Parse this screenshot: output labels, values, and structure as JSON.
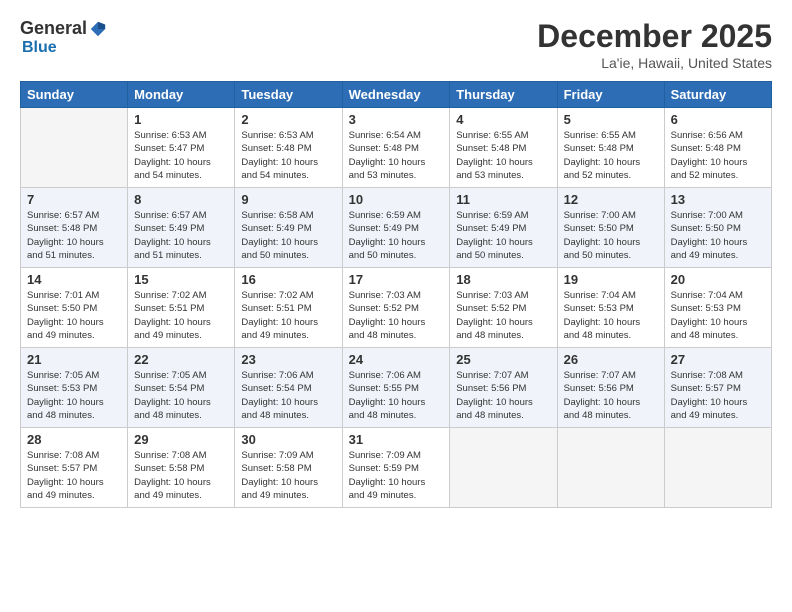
{
  "logo": {
    "general": "General",
    "blue": "Blue"
  },
  "title": "December 2025",
  "location": "La'ie, Hawaii, United States",
  "days_of_week": [
    "Sunday",
    "Monday",
    "Tuesday",
    "Wednesday",
    "Thursday",
    "Friday",
    "Saturday"
  ],
  "weeks": [
    [
      {
        "day": "",
        "empty": true
      },
      {
        "day": "1",
        "sunrise": "6:53 AM",
        "sunset": "5:47 PM",
        "daylight": "10 hours and 54 minutes."
      },
      {
        "day": "2",
        "sunrise": "6:53 AM",
        "sunset": "5:48 PM",
        "daylight": "10 hours and 54 minutes."
      },
      {
        "day": "3",
        "sunrise": "6:54 AM",
        "sunset": "5:48 PM",
        "daylight": "10 hours and 53 minutes."
      },
      {
        "day": "4",
        "sunrise": "6:55 AM",
        "sunset": "5:48 PM",
        "daylight": "10 hours and 53 minutes."
      },
      {
        "day": "5",
        "sunrise": "6:55 AM",
        "sunset": "5:48 PM",
        "daylight": "10 hours and 52 minutes."
      },
      {
        "day": "6",
        "sunrise": "6:56 AM",
        "sunset": "5:48 PM",
        "daylight": "10 hours and 52 minutes."
      }
    ],
    [
      {
        "day": "7",
        "sunrise": "6:57 AM",
        "sunset": "5:48 PM",
        "daylight": "10 hours and 51 minutes."
      },
      {
        "day": "8",
        "sunrise": "6:57 AM",
        "sunset": "5:49 PM",
        "daylight": "10 hours and 51 minutes."
      },
      {
        "day": "9",
        "sunrise": "6:58 AM",
        "sunset": "5:49 PM",
        "daylight": "10 hours and 50 minutes."
      },
      {
        "day": "10",
        "sunrise": "6:59 AM",
        "sunset": "5:49 PM",
        "daylight": "10 hours and 50 minutes."
      },
      {
        "day": "11",
        "sunrise": "6:59 AM",
        "sunset": "5:49 PM",
        "daylight": "10 hours and 50 minutes."
      },
      {
        "day": "12",
        "sunrise": "7:00 AM",
        "sunset": "5:50 PM",
        "daylight": "10 hours and 50 minutes."
      },
      {
        "day": "13",
        "sunrise": "7:00 AM",
        "sunset": "5:50 PM",
        "daylight": "10 hours and 49 minutes."
      }
    ],
    [
      {
        "day": "14",
        "sunrise": "7:01 AM",
        "sunset": "5:50 PM",
        "daylight": "10 hours and 49 minutes."
      },
      {
        "day": "15",
        "sunrise": "7:02 AM",
        "sunset": "5:51 PM",
        "daylight": "10 hours and 49 minutes."
      },
      {
        "day": "16",
        "sunrise": "7:02 AM",
        "sunset": "5:51 PM",
        "daylight": "10 hours and 49 minutes."
      },
      {
        "day": "17",
        "sunrise": "7:03 AM",
        "sunset": "5:52 PM",
        "daylight": "10 hours and 48 minutes."
      },
      {
        "day": "18",
        "sunrise": "7:03 AM",
        "sunset": "5:52 PM",
        "daylight": "10 hours and 48 minutes."
      },
      {
        "day": "19",
        "sunrise": "7:04 AM",
        "sunset": "5:53 PM",
        "daylight": "10 hours and 48 minutes."
      },
      {
        "day": "20",
        "sunrise": "7:04 AM",
        "sunset": "5:53 PM",
        "daylight": "10 hours and 48 minutes."
      }
    ],
    [
      {
        "day": "21",
        "sunrise": "7:05 AM",
        "sunset": "5:53 PM",
        "daylight": "10 hours and 48 minutes."
      },
      {
        "day": "22",
        "sunrise": "7:05 AM",
        "sunset": "5:54 PM",
        "daylight": "10 hours and 48 minutes."
      },
      {
        "day": "23",
        "sunrise": "7:06 AM",
        "sunset": "5:54 PM",
        "daylight": "10 hours and 48 minutes."
      },
      {
        "day": "24",
        "sunrise": "7:06 AM",
        "sunset": "5:55 PM",
        "daylight": "10 hours and 48 minutes."
      },
      {
        "day": "25",
        "sunrise": "7:07 AM",
        "sunset": "5:56 PM",
        "daylight": "10 hours and 48 minutes."
      },
      {
        "day": "26",
        "sunrise": "7:07 AM",
        "sunset": "5:56 PM",
        "daylight": "10 hours and 48 minutes."
      },
      {
        "day": "27",
        "sunrise": "7:08 AM",
        "sunset": "5:57 PM",
        "daylight": "10 hours and 49 minutes."
      }
    ],
    [
      {
        "day": "28",
        "sunrise": "7:08 AM",
        "sunset": "5:57 PM",
        "daylight": "10 hours and 49 minutes."
      },
      {
        "day": "29",
        "sunrise": "7:08 AM",
        "sunset": "5:58 PM",
        "daylight": "10 hours and 49 minutes."
      },
      {
        "day": "30",
        "sunrise": "7:09 AM",
        "sunset": "5:58 PM",
        "daylight": "10 hours and 49 minutes."
      },
      {
        "day": "31",
        "sunrise": "7:09 AM",
        "sunset": "5:59 PM",
        "daylight": "10 hours and 49 minutes."
      },
      {
        "day": "",
        "empty": true
      },
      {
        "day": "",
        "empty": true
      },
      {
        "day": "",
        "empty": true
      }
    ]
  ]
}
